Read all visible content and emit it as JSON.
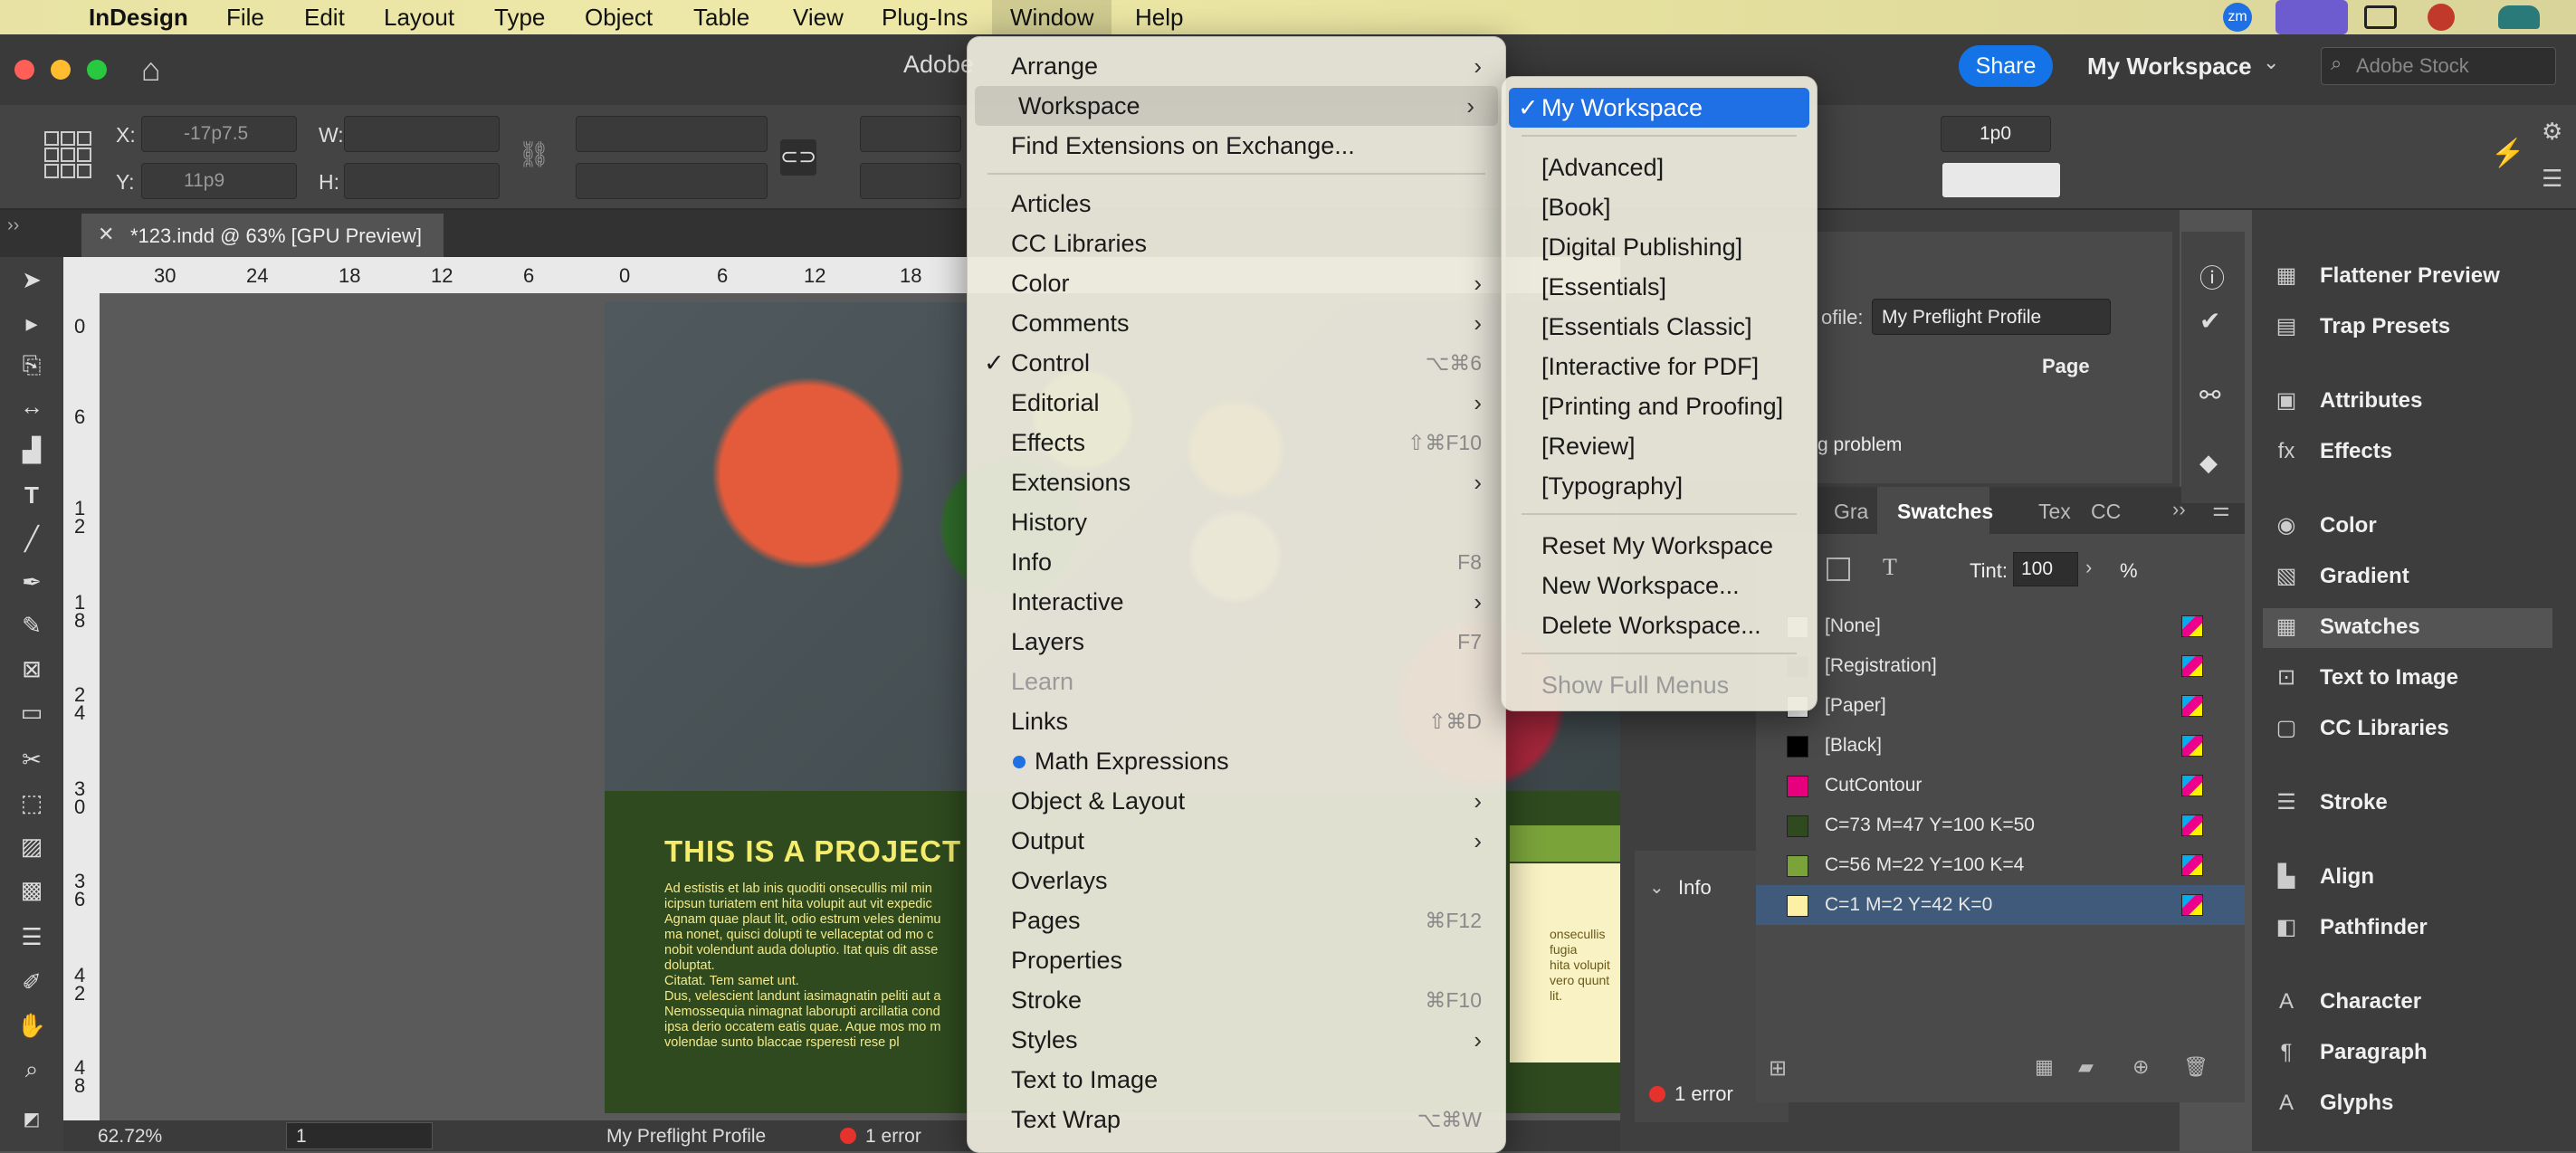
{
  "menubar": {
    "app": "InDesign",
    "items": [
      "File",
      "Edit",
      "Layout",
      "Type",
      "Object",
      "Table",
      "View",
      "Plug-Ins",
      "Window",
      "Help"
    ],
    "user_badge": "zm"
  },
  "titlebar": {
    "title_partial": "Adobe",
    "share": "Share",
    "workspace": "My Workspace",
    "stock_placeholder": "Adobe Stock"
  },
  "control": {
    "x_label": "X:",
    "x_value": "-17p7.5",
    "y_label": "Y:",
    "y_value": "11p9",
    "w_label": "W:",
    "h_label": "H:",
    "stroke_value": "1p0"
  },
  "document_tab": {
    "title": "*123.indd @ 63% [GPU Preview]"
  },
  "ruler_h": [
    "30",
    "24",
    "18",
    "12",
    "6",
    "0",
    "6",
    "12",
    "18"
  ],
  "ruler_v": [
    "0",
    "6",
    "1 2",
    "1 8",
    "2 4",
    "3 0",
    "3 6",
    "4 2",
    "4 8"
  ],
  "page": {
    "heading": "THIS IS A PROJECT",
    "body": [
      "Ad estistis et lab inis quoditi onsecullis mil min",
      "icipsun turiatem ent hita volupit aut vit expedic",
      "Agnam quae plaut lit, odio estrum veles denimu",
      "ma nonet, quisci dolupti te vellaceptat od mo c",
      "nobit volendunt auda doluptio. Itat quis dit asse",
      "doluptat.",
      "Citatat. Tem samet unt.",
      "Dus, velescient landunt iasimagnatin peliti aut a",
      "Nemossequia nimagnat laborupti arcillatia cond",
      "ipsa derio occatem eatis quae. Aque mos mo m",
      "volendae sunto blaccae rsperesti rese pl"
    ],
    "right_text": [
      "onsecullis",
      "fugia",
      "hita volupit",
      "vero quunt",
      "lit."
    ]
  },
  "status": {
    "zoom": "62.72%",
    "page": "1",
    "profile": "My Preflight Profile",
    "errors": "1 error"
  },
  "window_menu": {
    "items": [
      {
        "label": "Arrange",
        "arrow": true
      },
      {
        "label": "Workspace",
        "arrow": true,
        "highlight": true
      },
      {
        "label": "Find Extensions on Exchange..."
      },
      {
        "sep": true
      },
      {
        "label": "Articles"
      },
      {
        "label": "CC Libraries"
      },
      {
        "label": "Color",
        "arrow": true
      },
      {
        "label": "Comments",
        "arrow": true
      },
      {
        "label": "Control",
        "check": "✓",
        "shortcut": "⌥⌘6"
      },
      {
        "label": "Editorial",
        "arrow": true
      },
      {
        "label": "Effects",
        "shortcut": "⇧⌘F10"
      },
      {
        "label": "Extensions",
        "arrow": true
      },
      {
        "label": "History"
      },
      {
        "label": "Info",
        "shortcut": "F8"
      },
      {
        "label": "Interactive",
        "arrow": true
      },
      {
        "label": "Layers",
        "shortcut": "F7"
      },
      {
        "label": "Learn",
        "disabled": true
      },
      {
        "label": "Links",
        "shortcut": "⇧⌘D"
      },
      {
        "label": "Math Expressions",
        "dot": true
      },
      {
        "label": "Object & Layout",
        "arrow": true
      },
      {
        "label": "Output",
        "arrow": true
      },
      {
        "label": "Overlays"
      },
      {
        "label": "Pages",
        "shortcut": "⌘F12"
      },
      {
        "label": "Properties"
      },
      {
        "label": "Stroke",
        "shortcut": "⌘F10"
      },
      {
        "label": "Styles",
        "arrow": true
      },
      {
        "label": "Text to Image"
      },
      {
        "label": "Text Wrap",
        "shortcut": "⌥⌘W"
      }
    ]
  },
  "workspace_menu": {
    "items": [
      {
        "label": "My Workspace",
        "check": "✓",
        "selected": true
      },
      {
        "sep": true
      },
      {
        "label": "[Advanced]"
      },
      {
        "label": "[Book]"
      },
      {
        "label": "[Digital Publishing]"
      },
      {
        "label": "[Essentials]"
      },
      {
        "label": "[Essentials Classic]"
      },
      {
        "label": "[Interactive for PDF]"
      },
      {
        "label": "[Printing and Proofing]"
      },
      {
        "label": "[Review]"
      },
      {
        "label": "[Typography]"
      },
      {
        "sep": true
      },
      {
        "label": "Reset My Workspace"
      },
      {
        "label": "New Workspace..."
      },
      {
        "label": "Delete Workspace..."
      },
      {
        "sep": true
      },
      {
        "label": "Show Full Menus",
        "disabled": true
      }
    ]
  },
  "preflight": {
    "profile_label": "ofile:",
    "profile": "My Preflight Profile",
    "page_col": "Page",
    "problem": "g problem",
    "info": "Info",
    "errors": "1 error"
  },
  "swatches_panel": {
    "tabs": [
      "Gra",
      "Swatches",
      "Tex",
      "CC"
    ],
    "tint_label": "Tint:",
    "tint_value": "100",
    "percent": "%",
    "rows": [
      {
        "name": "[None]",
        "color": "#ffffff"
      },
      {
        "name": "[Registration]",
        "color": "#000000"
      },
      {
        "name": "[Paper]",
        "color": "#ffffff"
      },
      {
        "name": "[Black]",
        "color": "#000000"
      },
      {
        "name": "CutContour",
        "color": "#e6007e"
      },
      {
        "name": "C=73 M=47 Y=100 K=50",
        "color": "#2f4a1f"
      },
      {
        "name": "C=56 M=22 Y=100 K=4",
        "color": "#7aa33a"
      },
      {
        "name": "C=1 M=2 Y=42 K=0",
        "color": "#fbf0a3",
        "selected": true
      }
    ]
  },
  "right_panels": [
    {
      "label": "Flattener Preview",
      "icon": "flattener-icon",
      "glyph": "▦"
    },
    {
      "label": "Trap Presets",
      "icon": "trap-icon",
      "glyph": "▤"
    },
    {
      "label": "Attributes",
      "icon": "attributes-icon",
      "glyph": "▣"
    },
    {
      "label": "Effects",
      "icon": "fx-icon",
      "glyph": "fx"
    },
    {
      "label": "Color",
      "icon": "color-icon",
      "glyph": "◉"
    },
    {
      "label": "Gradient",
      "icon": "gradient-icon",
      "glyph": "▧"
    },
    {
      "label": "Swatches",
      "icon": "swatches-icon",
      "glyph": "▦",
      "active": true
    },
    {
      "label": "Text to Image",
      "icon": "text-to-image-icon",
      "glyph": "⊡"
    },
    {
      "label": "CC Libraries",
      "icon": "cc-libraries-icon",
      "glyph": "▢"
    },
    {
      "label": "Stroke",
      "icon": "stroke-icon",
      "glyph": "☰"
    },
    {
      "label": "Align",
      "icon": "align-icon",
      "glyph": "▙"
    },
    {
      "label": "Pathfinder",
      "icon": "pathfinder-icon",
      "glyph": "◧"
    },
    {
      "label": "Character",
      "icon": "character-icon",
      "glyph": "A"
    },
    {
      "label": "Paragraph",
      "icon": "paragraph-icon",
      "glyph": "¶"
    },
    {
      "label": "Glyphs",
      "icon": "glyphs-icon",
      "glyph": "A"
    }
  ],
  "colors": {
    "accent": "#1f6fe5",
    "doc_green": "#2f4a1f",
    "doc_yellow": "#f5ec6b",
    "error_red": "#e5322d"
  }
}
